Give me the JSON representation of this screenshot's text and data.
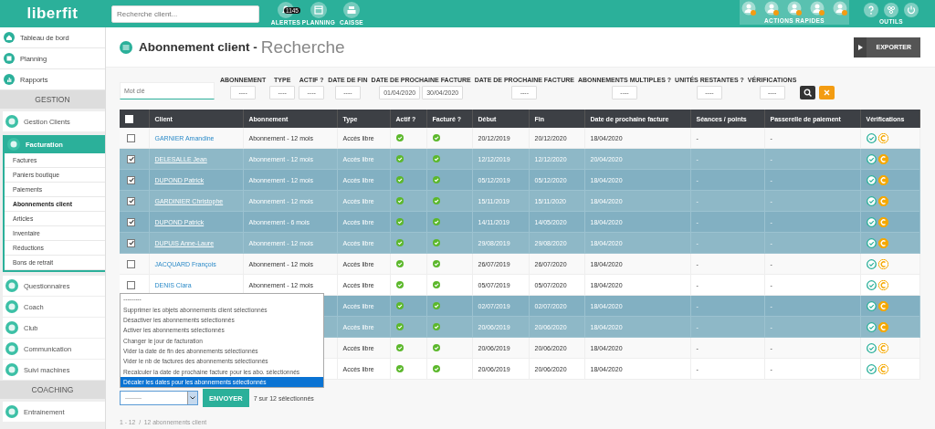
{
  "topbar": {
    "logo": "liberfit",
    "search": {
      "placeholder": "Recherche client..."
    },
    "nav": [
      {
        "label": "ALERTES",
        "badge": "1145"
      },
      {
        "label": "PLANNING"
      },
      {
        "label": "CAISSE"
      }
    ],
    "quick_actions": {
      "label": "ACTIONS RAPIDES"
    },
    "tools": {
      "label": "OUTILS"
    }
  },
  "sidebar": {
    "items": [
      {
        "label": "Tableau de bord"
      },
      {
        "label": "Planning"
      },
      {
        "label": "Rapports"
      }
    ],
    "sections": [
      {
        "title": "GESTION",
        "items": [
          {
            "label": "Gestion Clients",
            "expanded": false
          },
          {
            "label": "Facturation",
            "expanded": true,
            "children": [
              {
                "label": "Factures",
                "selected": false
              },
              {
                "label": "Paniers boutique",
                "selected": false
              },
              {
                "label": "Paiements",
                "selected": false
              },
              {
                "label": "Abonnements client",
                "selected": true
              },
              {
                "label": "Articles",
                "selected": false
              },
              {
                "label": "Inventaire",
                "selected": false
              },
              {
                "label": "Réductions",
                "selected": false
              },
              {
                "label": "Bons de retrait",
                "selected": false
              }
            ]
          },
          {
            "label": "Questionnaires",
            "expanded": false
          },
          {
            "label": "Coach",
            "expanded": false
          },
          {
            "label": "Club",
            "expanded": false
          },
          {
            "label": "Communication",
            "expanded": false
          },
          {
            "label": "Suivi machines",
            "expanded": false
          }
        ]
      },
      {
        "title": "COACHING",
        "items": [
          {
            "label": "Entrainement",
            "expanded": false
          }
        ]
      }
    ]
  },
  "page": {
    "title": "Abonnement client - ",
    "subtitle": "Recherche",
    "export_button": "EXPORTER"
  },
  "filters": {
    "keyword": {
      "placeholder": "Mot clé"
    },
    "fields": [
      {
        "label": "ABONNEMENT",
        "values": [
          "----"
        ]
      },
      {
        "label": "TYPE",
        "values": [
          "----"
        ]
      },
      {
        "label": "ACTIF ?",
        "values": [
          "----"
        ]
      },
      {
        "label": "DATE DE FIN",
        "values": [
          "----"
        ]
      },
      {
        "label": "DATE DE PROCHAINE FACTURE",
        "values": [
          "01/04/2020",
          "30/04/2020"
        ]
      },
      {
        "label": "DATE DE PROCHAINE FACTURE",
        "values": [
          "----"
        ]
      },
      {
        "label": "ABONNEMENTS MULTIPLES ?",
        "values": [
          "----"
        ]
      },
      {
        "label": "UNITÉS RESTANTES ?",
        "values": [
          "----"
        ]
      },
      {
        "label": "VÉRIFICATIONS",
        "values": [
          "----"
        ]
      }
    ]
  },
  "table": {
    "select_all": {
      "checked": false
    },
    "columns": [
      "Client",
      "Abonnement",
      "Type",
      "Actif ?",
      "Facturé ?",
      "Début",
      "Fin",
      "Date de prochaine facture",
      "Séances / points",
      "Passerelle de paiement",
      "Vérifications"
    ],
    "rows": [
      {
        "selected": false,
        "client": "GARNIER Amandine",
        "subscription": "Abonnement - 12 mois",
        "type": "Accès libre",
        "active": true,
        "invoiced": true,
        "start": "20/12/2019",
        "end": "20/12/2020",
        "next_invoice": "18/04/2020",
        "sessions": "-",
        "gateway": "-"
      },
      {
        "selected": true,
        "client": "DELESALLE Jean",
        "subscription": "Abonnement - 12 mois",
        "type": "Accès libre",
        "active": true,
        "invoiced": true,
        "start": "12/12/2019",
        "end": "12/12/2020",
        "next_invoice": "20/04/2020",
        "sessions": "-",
        "gateway": "-"
      },
      {
        "selected": true,
        "client": "DUPOND Patrick",
        "subscription": "Abonnement - 12 mois",
        "type": "Accès libre",
        "active": true,
        "invoiced": true,
        "start": "05/12/2019",
        "end": "05/12/2020",
        "next_invoice": "18/04/2020",
        "sessions": "-",
        "gateway": "-"
      },
      {
        "selected": true,
        "client": "GARDINIER Christophe",
        "subscription": "Abonnement - 12 mois",
        "type": "Accès libre",
        "active": true,
        "invoiced": true,
        "start": "15/11/2019",
        "end": "15/11/2020",
        "next_invoice": "18/04/2020",
        "sessions": "-",
        "gateway": "-"
      },
      {
        "selected": true,
        "client": "DUPOND Patrick",
        "subscription": "Abonnement - 6 mois",
        "type": "Accès libre",
        "active": true,
        "invoiced": true,
        "start": "14/11/2019",
        "end": "14/05/2020",
        "next_invoice": "18/04/2020",
        "sessions": "-",
        "gateway": "-"
      },
      {
        "selected": true,
        "client": "DUPUIS Anne-Laure",
        "subscription": "Abonnement - 12 mois",
        "type": "Accès libre",
        "active": true,
        "invoiced": true,
        "start": "29/08/2019",
        "end": "29/08/2020",
        "next_invoice": "18/04/2020",
        "sessions": "-",
        "gateway": "-"
      },
      {
        "selected": false,
        "client": "JACQUARD François",
        "subscription": "Abonnement - 12 mois",
        "type": "Accès libre",
        "active": true,
        "invoiced": true,
        "start": "26/07/2019",
        "end": "26/07/2020",
        "next_invoice": "18/04/2020",
        "sessions": "-",
        "gateway": "-"
      },
      {
        "selected": false,
        "client": "DENIS Clara",
        "subscription": "Abonnement - 12 mois",
        "type": "Accès libre",
        "active": true,
        "invoiced": true,
        "start": "05/07/2019",
        "end": "05/07/2020",
        "next_invoice": "18/04/2020",
        "sessions": "-",
        "gateway": "-"
      },
      {
        "selected": true,
        "type": "Accès libre",
        "active": true,
        "invoiced": true,
        "start": "02/07/2019",
        "end": "02/07/2020",
        "next_invoice": "18/04/2020",
        "sessions": "-",
        "gateway": "-"
      },
      {
        "selected": true,
        "type": "Accès libre",
        "active": true,
        "invoiced": true,
        "start": "20/06/2019",
        "end": "20/06/2020",
        "next_invoice": "18/04/2020",
        "sessions": "-",
        "gateway": "-"
      },
      {
        "selected": false,
        "type": "Accès libre",
        "active": true,
        "invoiced": true,
        "start": "20/06/2019",
        "end": "20/06/2020",
        "next_invoice": "18/04/2020",
        "sessions": "-",
        "gateway": "-"
      },
      {
        "selected": false,
        "type": "Accès libre",
        "active": true,
        "invoiced": true,
        "start": "20/06/2019",
        "end": "20/06/2020",
        "next_invoice": "18/04/2020",
        "sessions": "-",
        "gateway": "-"
      }
    ]
  },
  "bulk_actions": {
    "options": [
      {
        "label": "---------",
        "selected": false
      },
      {
        "label": "Supprimer les objets abonnements client sélectionnés",
        "selected": false
      },
      {
        "label": "Désactiver les abonnements sélectionnés",
        "selected": false
      },
      {
        "label": "Activer les abonnements sélectionnés",
        "selected": false
      },
      {
        "label": "Changer le jour de facturation",
        "selected": false
      },
      {
        "label": "Vider la date de fin des abonnements sélectionnés",
        "selected": false
      },
      {
        "label": "Vider le nb de factures des abonnements sélectionnés",
        "selected": false
      },
      {
        "label": "Recalculer la date de prochaine facture pour les abo. sélectionnés",
        "selected": false
      },
      {
        "label": "Décaler les dates pour les abonnements sélectionnés",
        "selected": true
      }
    ],
    "select": {
      "value": "---------",
      "expanded": true
    },
    "button": "ENVOYER",
    "count": "7 sur 12 sélectionnés"
  },
  "pagination": "1 - 12  /  12 abonnements client"
}
